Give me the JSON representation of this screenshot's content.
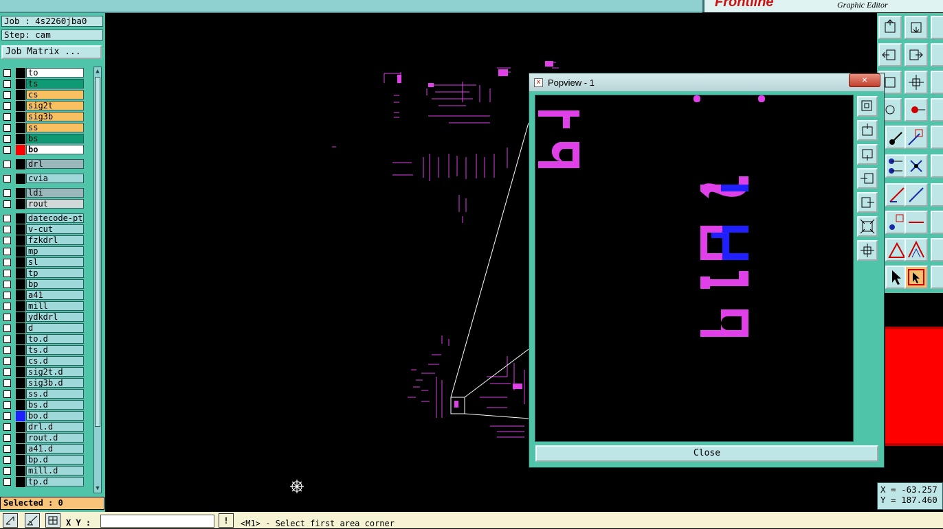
{
  "app": {
    "brand": "Frontline",
    "subtitle": "Graphic Editor"
  },
  "job": {
    "job_line": "Job : 4s2260jba0",
    "step_line": "Step: cam",
    "matrix_button": "Job Matrix ..."
  },
  "layers": [
    {
      "name": "to",
      "color": "#ffffff"
    },
    {
      "name": "ts",
      "color": "#0f9a74"
    },
    {
      "name": "cs",
      "color": "#f8c060"
    },
    {
      "name": "sig2t",
      "color": "#f8c060"
    },
    {
      "name": "sig3b",
      "color": "#f8c060"
    },
    {
      "name": "ss",
      "color": "#f8c060"
    },
    {
      "name": "bs",
      "color": "#0f9a74"
    },
    {
      "name": "bo",
      "color": "#ffffff"
    },
    {
      "name": "drl",
      "color": "#9ab8bc"
    },
    {
      "name": "cvia",
      "color": "#9fd8d8"
    },
    {
      "name": "ldi",
      "color": "#9ab8bc"
    },
    {
      "name": "rout",
      "color": "#d0d8d8"
    },
    {
      "name": "datecode-pte",
      "color": "#9fd8d8"
    },
    {
      "name": "v-cut",
      "color": "#9fd8d8"
    },
    {
      "name": "fzkdrl",
      "color": "#9fd8d8"
    },
    {
      "name": "mp",
      "color": "#9fd8d8"
    },
    {
      "name": "sl",
      "color": "#9fd8d8"
    },
    {
      "name": "tp",
      "color": "#9fd8d8"
    },
    {
      "name": "bp",
      "color": "#9fd8d8"
    },
    {
      "name": "a41",
      "color": "#9fd8d8"
    },
    {
      "name": "mill",
      "color": "#9fd8d8"
    },
    {
      "name": "ydkdrl",
      "color": "#9fd8d8"
    },
    {
      "name": "d",
      "color": "#9fd8d8"
    },
    {
      "name": "to.d",
      "color": "#9fd8d8"
    },
    {
      "name": "ts.d",
      "color": "#9fd8d8"
    },
    {
      "name": "cs.d",
      "color": "#9fd8d8"
    },
    {
      "name": "sig2t.d",
      "color": "#9fd8d8"
    },
    {
      "name": "sig3b.d",
      "color": "#9fd8d8"
    },
    {
      "name": "ss.d",
      "color": "#9fd8d8"
    },
    {
      "name": "bs.d",
      "color": "#9fd8d8"
    },
    {
      "name": "bo.d",
      "color": "#9fd8d8"
    },
    {
      "name": "drl.d",
      "color": "#9fd8d8"
    },
    {
      "name": "rout.d",
      "color": "#9fd8d8"
    },
    {
      "name": "a41.d",
      "color": "#9fd8d8"
    },
    {
      "name": "bp.d",
      "color": "#9fd8d8"
    },
    {
      "name": "mill.d",
      "color": "#9fd8d8"
    },
    {
      "name": "tp.d",
      "color": "#9fd8d8"
    }
  ],
  "selected": "Selected : 0",
  "bottom": {
    "xy_label": "X Y :",
    "xy_value": "",
    "prompt": "<M1> - Select first area corner"
  },
  "coords": {
    "x": "X = -63.257",
    "y": "Y = 187.460"
  },
  "popview": {
    "title": "Popview - 1",
    "close_button": "Close",
    "close_glyph": "×"
  },
  "colors": {
    "panel": "#4fc4a8",
    "feature": "#e040e8",
    "accent_blue": "#2020ff",
    "highlight_red": "#ff0000"
  }
}
